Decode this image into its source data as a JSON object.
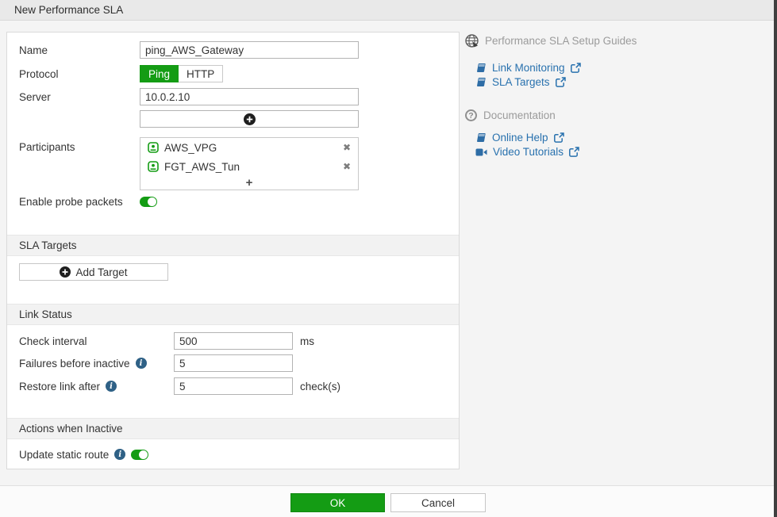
{
  "title": "New Performance SLA",
  "form": {
    "name_label": "Name",
    "name_value": "ping_AWS_Gateway",
    "protocol_label": "Protocol",
    "protocol_options": [
      "Ping",
      "HTTP"
    ],
    "protocol_selected": "Ping",
    "server_label": "Server",
    "server_value": "10.0.2.10",
    "participants_label": "Participants",
    "participants": [
      {
        "name": "AWS_VPG"
      },
      {
        "name": "FGT_AWS_Tun"
      }
    ],
    "enable_probe_label": "Enable probe packets",
    "enable_probe_on": true,
    "sections": {
      "sla_targets": "SLA Targets",
      "link_status": "Link Status",
      "actions_inactive": "Actions when Inactive"
    },
    "add_target_label": "Add Target",
    "check_interval_label": "Check interval",
    "check_interval_value": "500",
    "check_interval_unit": "ms",
    "failures_label": "Failures before inactive",
    "failures_value": "5",
    "restore_label": "Restore link after",
    "restore_value": "5",
    "restore_unit": "check(s)",
    "update_static_label": "Update static route",
    "update_static_on": true
  },
  "sidebar": {
    "guides_header": "Performance SLA Setup Guides",
    "guides_links": [
      {
        "label": "Link Monitoring",
        "icon": "book-icon"
      },
      {
        "label": "SLA Targets",
        "icon": "book-icon"
      }
    ],
    "docs_header": "Documentation",
    "docs_links": [
      {
        "label": "Online Help",
        "icon": "book-icon"
      },
      {
        "label": "Video Tutorials",
        "icon": "video-camera-icon"
      }
    ]
  },
  "footer": {
    "ok_label": "OK",
    "cancel_label": "Cancel"
  },
  "icons": {
    "remove_glyph": "✖",
    "add_glyph": "+"
  },
  "colors": {
    "accent_green": "#149c14",
    "link_blue": "#2871ae",
    "info_blue": "#2f6186"
  }
}
